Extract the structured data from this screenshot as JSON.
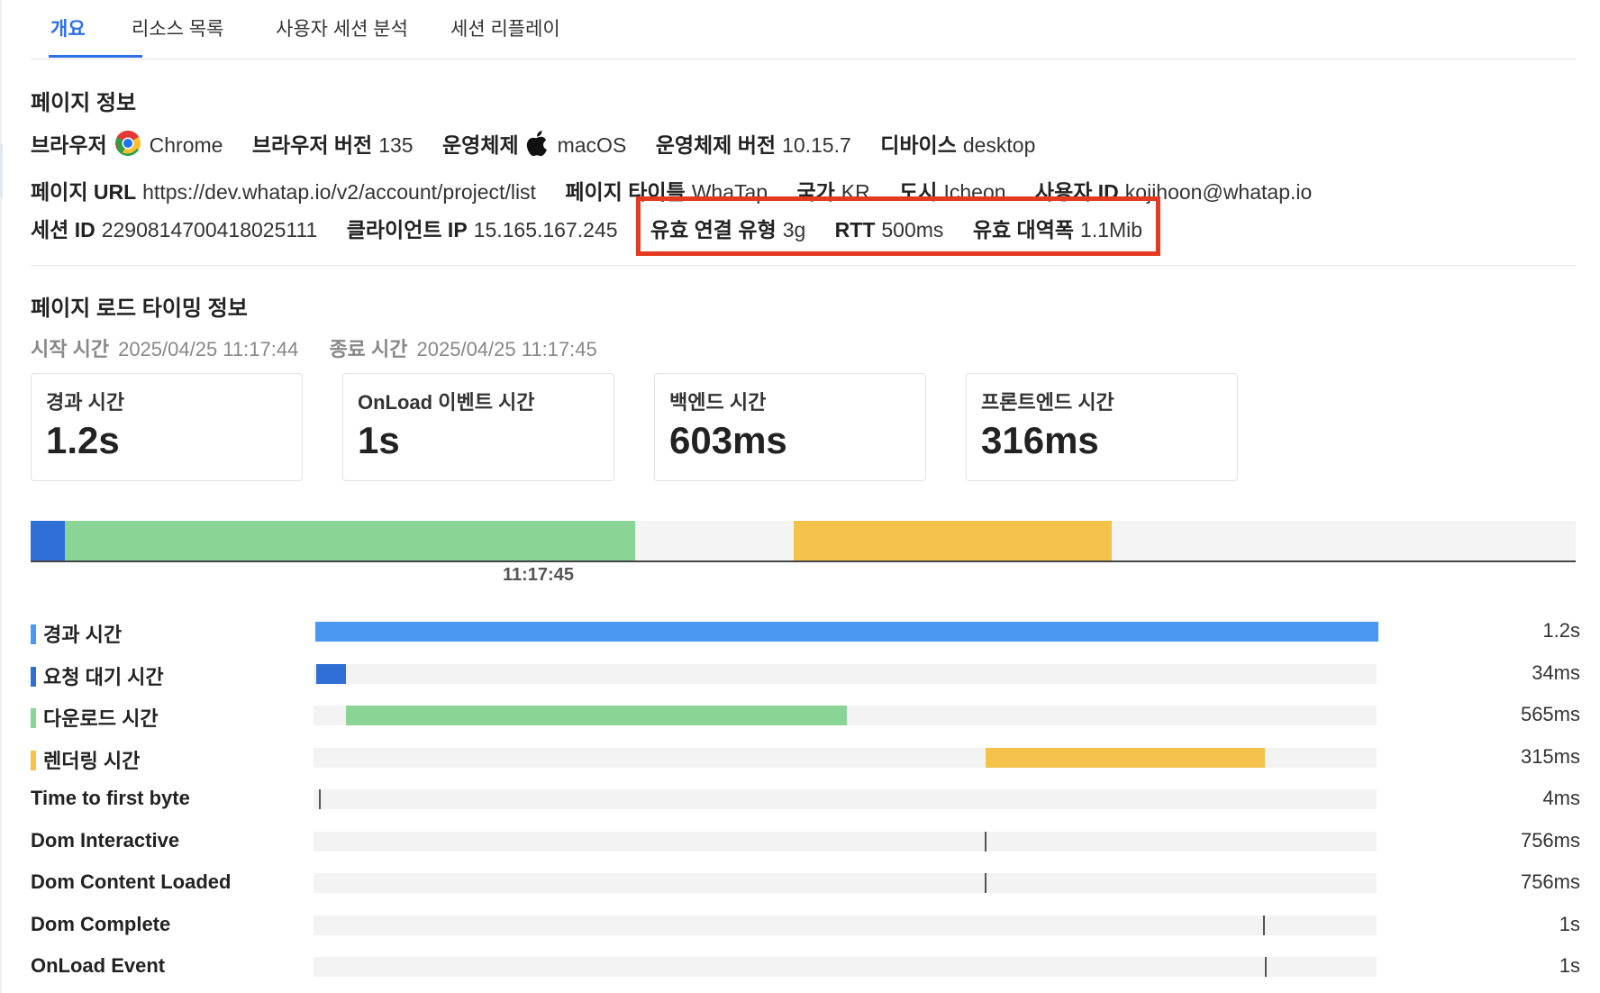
{
  "tabs": [
    {
      "label": "개요",
      "active": true
    },
    {
      "label": "리소스 목록",
      "active": false
    },
    {
      "label": "사용자 세션 분석",
      "active": false
    },
    {
      "label": "세션 리플레이",
      "active": false
    }
  ],
  "page_info": {
    "title": "페이지 정보",
    "browser_label": "브라우저",
    "browser_value": "Chrome",
    "browser_version_label": "브라우저 버전",
    "browser_version_value": "135",
    "os_label": "운영체제",
    "os_value": "macOS",
    "os_version_label": "운영체제 버전",
    "os_version_value": "10.15.7",
    "device_label": "디바이스",
    "device_value": "desktop",
    "page_url_label": "페이지 URL",
    "page_url_value": "https://dev.whatap.io/v2/account/project/list",
    "page_title_label": "페이지 타이틀",
    "page_title_value": "WhaTap",
    "country_label": "국가",
    "country_value": "KR",
    "city_label": "도시",
    "city_value": "Icheon",
    "user_id_label": "사용자 ID",
    "user_id_value": "kojihoon@whatap.io",
    "session_id_label": "세션 ID",
    "session_id_value": "2290814700418025111",
    "client_ip_label": "클라이언트 IP",
    "client_ip_value": "15.165.167.245",
    "eff_conn_label": "유효 연결 유형",
    "eff_conn_value": "3g",
    "rtt_label": "RTT",
    "rtt_value": "500ms",
    "bandwidth_label": "유효 대역폭",
    "bandwidth_value": "1.1Mib"
  },
  "timing": {
    "title": "페이지 로드 타이밍 정보",
    "start_label": "시작 시간",
    "start_value": "2025/04/25 11:17:44",
    "end_label": "종료 시간",
    "end_value": "2025/04/25 11:17:45",
    "cards": [
      {
        "label": "경과 시간",
        "value": "1.2s"
      },
      {
        "label": "OnLoad 이벤트 시간",
        "value": "1s"
      },
      {
        "label": "백엔드 시간",
        "value": "603ms"
      },
      {
        "label": "프론트엔드 시간",
        "value": "316ms"
      }
    ],
    "overview_tick": "11:17:45",
    "waterfall": [
      {
        "label": "경과 시간",
        "value": "1.2s",
        "color": "#4a98f2",
        "start": 0,
        "duration": 1200,
        "kind": "bar",
        "swatch": true
      },
      {
        "label": "요청 대기 시간",
        "value": "34ms",
        "color": "#2f6fd6",
        "start": 0,
        "duration": 34,
        "kind": "bar",
        "swatch": true
      },
      {
        "label": "다운로드 시간",
        "value": "565ms",
        "color": "#8ad596",
        "start": 34,
        "duration": 565,
        "kind": "bar",
        "swatch": true
      },
      {
        "label": "렌더링 시간",
        "value": "315ms",
        "color": "#f5c24c",
        "start": 756,
        "duration": 315,
        "kind": "bar",
        "swatch": true
      },
      {
        "label": "Time to first byte",
        "value": "4ms",
        "start": 4,
        "kind": "mark",
        "swatch": false
      },
      {
        "label": "Dom Interactive",
        "value": "756ms",
        "start": 756,
        "kind": "mark",
        "swatch": false
      },
      {
        "label": "Dom Content Loaded",
        "value": "756ms",
        "start": 756,
        "kind": "mark",
        "swatch": false
      },
      {
        "label": "Dom Complete",
        "value": "1s",
        "start": 1070,
        "kind": "mark",
        "swatch": false
      },
      {
        "label": "OnLoad Event",
        "value": "1s",
        "start": 1072,
        "kind": "mark",
        "swatch": false
      }
    ],
    "timeline_total_ms": 1500
  }
}
